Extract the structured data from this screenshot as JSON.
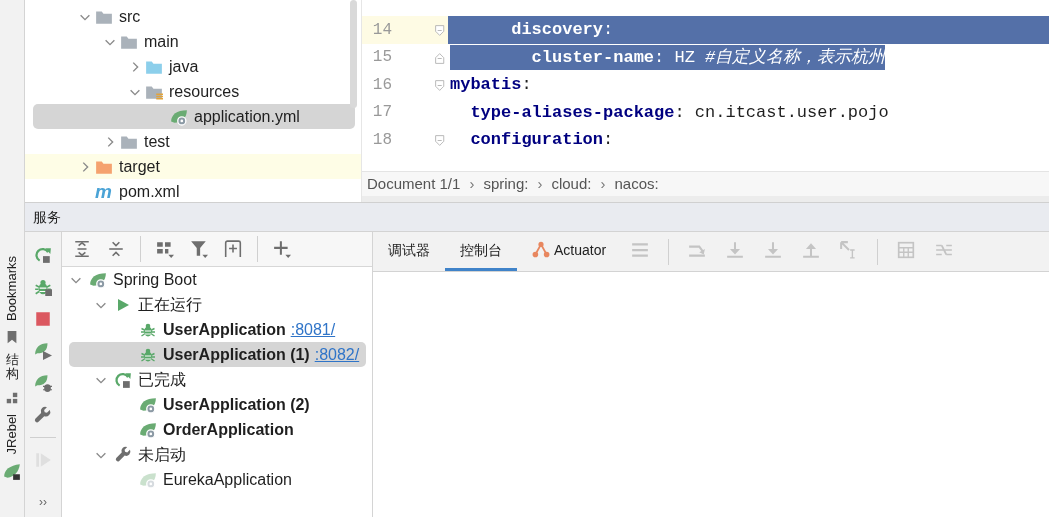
{
  "side_strip": [
    {
      "label": "Bookmarks",
      "kind": "bookmarks"
    },
    {
      "label": "结构",
      "kind": "structure"
    },
    {
      "label": "JRebel",
      "kind": "jrebel"
    }
  ],
  "project_tree": [
    {
      "label": "src",
      "kind": "folder",
      "expanded": true,
      "selected": false,
      "highlighted": false,
      "children": [
        {
          "label": "main",
          "kind": "folder",
          "expanded": true,
          "selected": false,
          "highlighted": false,
          "children": [
            {
              "label": "java",
              "kind": "source-folder",
              "expanded": false,
              "selected": false,
              "highlighted": false
            },
            {
              "label": "resources",
              "kind": "resources-folder",
              "expanded": true,
              "selected": false,
              "highlighted": false,
              "children": [
                {
                  "label": "application.yml",
                  "kind": "spring-file",
                  "selected": true,
                  "highlighted": false
                }
              ]
            }
          ]
        },
        {
          "label": "test",
          "kind": "folder",
          "expanded": false,
          "selected": false,
          "highlighted": false
        }
      ]
    },
    {
      "label": "target",
      "kind": "excluded-folder",
      "expanded": false,
      "selected": false,
      "highlighted": true
    },
    {
      "label": "pom.xml",
      "kind": "maven-file",
      "glyph": "m",
      "selected": false,
      "highlighted": false
    }
  ],
  "editor": {
    "lines": [
      {
        "number": "14",
        "current": true,
        "fold_start": true,
        "fold_end": false,
        "selected": true,
        "tokens": [
          {
            "kind": "key",
            "text": "      discovery"
          },
          {
            "kind": "punct",
            "text": ":"
          }
        ]
      },
      {
        "number": "15",
        "current": false,
        "fold_start": false,
        "fold_end": true,
        "selected": true,
        "tokens": [
          {
            "kind": "key",
            "text": "        cluster-name"
          },
          {
            "kind": "punct",
            "text": ": "
          },
          {
            "kind": "value",
            "text": "HZ "
          },
          {
            "kind": "comment",
            "text": "#自定义名称，表示杭州"
          }
        ]
      },
      {
        "number": "16",
        "current": false,
        "fold_start": true,
        "fold_end": false,
        "selected": false,
        "tokens": [
          {
            "kind": "key",
            "text": "mybatis"
          },
          {
            "kind": "punct",
            "text": ":"
          }
        ]
      },
      {
        "number": "17",
        "current": false,
        "fold_start": false,
        "fold_end": false,
        "selected": false,
        "tokens": [
          {
            "kind": "key",
            "text": "  type-aliases-package"
          },
          {
            "kind": "punct",
            "text": ": "
          },
          {
            "kind": "value",
            "text": "cn.itcast.user.pojo"
          }
        ]
      },
      {
        "number": "18",
        "current": false,
        "fold_start": true,
        "fold_end": false,
        "selected": false,
        "tokens": [
          {
            "kind": "key",
            "text": "  configuration"
          },
          {
            "kind": "punct",
            "text": ":"
          }
        ]
      }
    ],
    "breadcrumb": {
      "separator": "›",
      "items": [
        "Document 1/1",
        "spring:",
        "cloud:",
        "nacos:"
      ]
    }
  },
  "services": {
    "title": "服务",
    "tools": [
      {
        "kind": "rerun",
        "disabled": false
      },
      {
        "kind": "debug-rerun",
        "disabled": false
      },
      {
        "kind": "stop",
        "disabled": false
      },
      {
        "kind": "spring-run",
        "disabled": false
      },
      {
        "kind": "spring-debug",
        "disabled": false
      },
      {
        "kind": "wrench",
        "disabled": false
      },
      {
        "kind": "separator"
      },
      {
        "kind": "resume",
        "disabled": true
      }
    ],
    "more": "››",
    "tree_toolbar": [
      {
        "kind": "expand-all"
      },
      {
        "kind": "collapse-all"
      },
      {
        "kind": "separator"
      },
      {
        "kind": "group"
      },
      {
        "kind": "filter"
      },
      {
        "kind": "new-tab"
      },
      {
        "kind": "separator"
      },
      {
        "kind": "add"
      }
    ],
    "tree": [
      {
        "label": "Spring Boot",
        "kind": "spring-boot",
        "expanded": true,
        "selected": false,
        "children": [
          {
            "label": "正在运行",
            "kind": "running-group",
            "expanded": true,
            "selected": false,
            "children": [
              {
                "label": "UserApplication",
                "port": ":8081/",
                "kind": "debugging",
                "selected": false
              },
              {
                "label": "UserApplication (1)",
                "port": ":8082/",
                "kind": "debugging",
                "selected": true
              }
            ]
          },
          {
            "label": "已完成",
            "kind": "finished-group",
            "expanded": true,
            "selected": false,
            "children": [
              {
                "label": "UserApplication (2)",
                "kind": "finished",
                "selected": false
              },
              {
                "label": "OrderApplication",
                "kind": "finished",
                "selected": false
              }
            ]
          },
          {
            "label": "未启动",
            "kind": "idle-group",
            "expanded": true,
            "selected": false,
            "children": [
              {
                "label": "EurekaApplication",
                "kind": "idle",
                "selected": false
              }
            ]
          }
        ]
      }
    ],
    "console_tabs": [
      {
        "label": "调试器",
        "kind": "plain",
        "selected": false
      },
      {
        "label": "控制台",
        "kind": "plain",
        "selected": true
      },
      {
        "label": "Actuator",
        "kind": "actuator",
        "selected": false
      }
    ],
    "console_toolbar": [
      {
        "kind": "menu",
        "disabled": true
      },
      {
        "kind": "separator"
      },
      {
        "kind": "soft-wrap",
        "disabled": true
      },
      {
        "kind": "scroll-end",
        "disabled": true
      },
      {
        "kind": "download",
        "disabled": true
      },
      {
        "kind": "upload",
        "disabled": true
      },
      {
        "kind": "cursor",
        "disabled": true
      },
      {
        "kind": "separator"
      },
      {
        "kind": "table",
        "disabled": true
      },
      {
        "kind": "compare",
        "disabled": true
      }
    ]
  }
}
